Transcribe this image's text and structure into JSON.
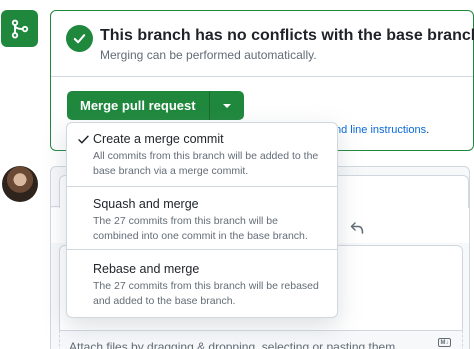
{
  "merge_status": {
    "title": "This branch has no conflicts with the base branch",
    "subtitle": "Merging can be performed automatically."
  },
  "merge_button": {
    "label": "Merge pull request"
  },
  "cli_link": {
    "text": "nd line instructions",
    "trail": "."
  },
  "merge_menu": {
    "items": [
      {
        "title": "Create a merge commit",
        "desc_line1": "All commits from this branch will be added to the",
        "desc_line2": "base branch via a merge commit.",
        "selected": true
      },
      {
        "title": "Squash and merge",
        "desc_line1": "The 27 commits from this branch will be",
        "desc_line2": "combined into one commit in the base branch.",
        "selected": false
      },
      {
        "title": "Rebase and merge",
        "desc_line1": "The 27 commits from this branch will be rebased",
        "desc_line2": "and added to the base branch.",
        "selected": false
      }
    ]
  },
  "comment": {
    "attach_text": "Attach files by dragging & dropping, selecting or pasting them."
  },
  "icons": {
    "merge": "git-merge-icon",
    "status": "check-circle-icon",
    "dropdown": "triangle-down-icon",
    "selected": "check-icon",
    "undo": "reply-icon",
    "markdown": "markdown-icon"
  },
  "colors": {
    "success": "#1f883d",
    "link": "#0969da",
    "border": "#d0d7de",
    "muted": "#636c76"
  }
}
